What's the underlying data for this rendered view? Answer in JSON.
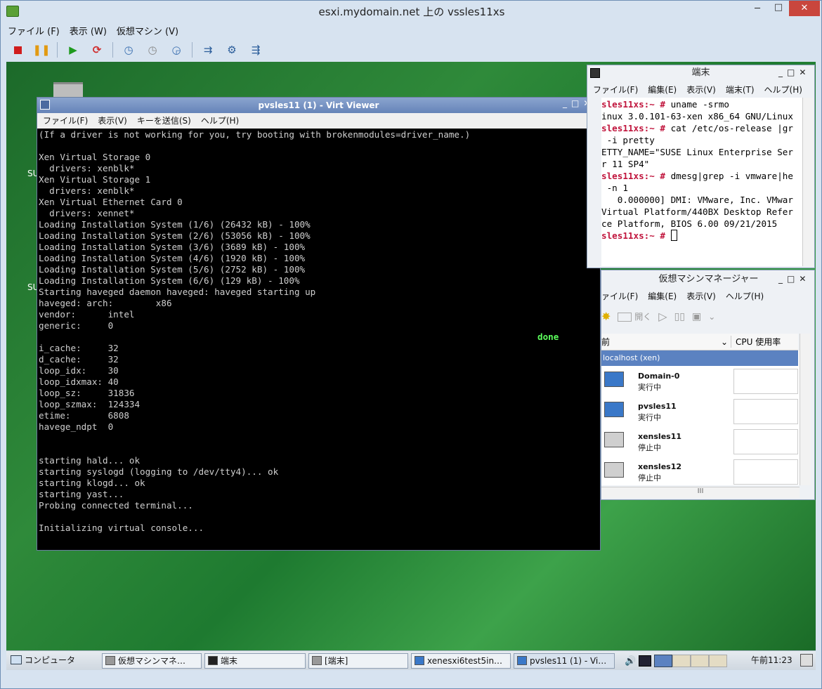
{
  "outer": {
    "title": "esxi.mydomain.net 上の vssles11xs",
    "menu": [
      "ファイル (F)",
      "表示 (W)",
      "仮想マシン (V)"
    ],
    "toolbar_icons": [
      "stop-icon",
      "pause-icon",
      "play-icon",
      "restart-icon",
      "snapshot-icon",
      "snapshot-revert-icon",
      "snapshot-manager-icon",
      "console-icon",
      "settings-icon",
      "devices-icon"
    ],
    "min": "─",
    "max": "□",
    "close": "✕"
  },
  "desktop": {
    "label1": "SU",
    "label2": "SU"
  },
  "virt_viewer": {
    "title": "pvsles11 (1) - Virt Viewer",
    "controls": "_□✕",
    "menu": [
      "ファイル(F)",
      "表示(V)",
      "キーを送信(S)",
      "ヘルプ(H)"
    ],
    "console_lines": [
      "(If a driver is not working for you, try booting with brokenmodules=driver_name.)",
      "",
      "Xen Virtual Storage 0",
      "  drivers: xenblk*",
      "Xen Virtual Storage 1",
      "  drivers: xenblk*",
      "Xen Virtual Ethernet Card 0",
      "  drivers: xennet*",
      "Loading Installation System (1/6) (26432 kB) - 100%",
      "Loading Installation System (2/6) (53056 kB) - 100%",
      "Loading Installation System (3/6) (3689 kB) - 100%",
      "Loading Installation System (4/6) (1920 kB) - 100%",
      "Loading Installation System (5/6) (2752 kB) - 100%",
      "Loading Installation System (6/6) (129 kB) - 100%",
      "Starting haveged daemon haveged: haveged starting up",
      "haveged: arch:        x86",
      "vendor:      intel",
      "generic:     0",
      "",
      "i_cache:     32",
      "d_cache:     32",
      "loop_idx:    30",
      "loop_idxmax: 40",
      "loop_sz:     31836",
      "loop_szmax:  124334",
      "etime:       6808",
      "havege_ndpt  0",
      "",
      "",
      "starting hald... ok",
      "starting syslogd (logging to /dev/tty4)... ok",
      "starting klogd... ok",
      "starting yast...",
      "Probing connected terminal...",
      "",
      "Initializing virtual console..."
    ],
    "done": "done"
  },
  "terminal": {
    "title": "端末",
    "controls": "_□✕",
    "menu": [
      "ファイル(F)",
      "編集(E)",
      "表示(V)",
      "端末(T)",
      "ヘルプ(H)"
    ],
    "lines": [
      {
        "prompt": "sles11xs:~ # ",
        "text": "uname -srmo"
      },
      {
        "prompt": "",
        "text": "inux 3.0.101-63-xen x86_64 GNU/Linux"
      },
      {
        "prompt": "sles11xs:~ # ",
        "text": "cat /etc/os-release |gr"
      },
      {
        "prompt": "",
        "text": " -i pretty"
      },
      {
        "prompt": "",
        "text": "ETTY_NAME=\"SUSE Linux Enterprise Ser"
      },
      {
        "prompt": "",
        "text": "r 11 SP4\""
      },
      {
        "prompt": "sles11xs:~ # ",
        "text": "dmesg|grep -i vmware|he"
      },
      {
        "prompt": "",
        "text": " -n 1"
      },
      {
        "prompt": "",
        "text": "   0.000000] DMI: VMware, Inc. VMwar"
      },
      {
        "prompt": "",
        "text": "Virtual Platform/440BX Desktop Refer"
      },
      {
        "prompt": "",
        "text": "ce Platform, BIOS 6.00 09/21/2015"
      },
      {
        "prompt": "sles11xs:~ # ",
        "text": ""
      }
    ]
  },
  "vmm": {
    "title": "仮想マシンマネージャー",
    "controls": "_□✕",
    "menu": [
      "ァイル(F)",
      "編集(E)",
      "表示(V)",
      "ヘルプ(H)"
    ],
    "toolbar": {
      "open": "開く"
    },
    "col_name": "前",
    "col_cpu": "CPU 使用率",
    "group": "localhost (xen)",
    "vms": [
      {
        "name": "Domain-0",
        "state": "実行中",
        "running": true
      },
      {
        "name": "pvsles11",
        "state": "実行中",
        "running": true
      },
      {
        "name": "xensles11",
        "state": "停止中",
        "running": false
      },
      {
        "name": "xensles12",
        "state": "停止中",
        "running": false
      }
    ],
    "hscroll": "III"
  },
  "taskbar": {
    "start": "コンピュータ",
    "tasks": [
      "仮想マシンマネ…",
      "端末",
      "[端末]",
      "xenesxi6test5in…",
      "pvsles11 (1) - Vi…"
    ],
    "clock": "午前11:23"
  },
  "colors": {
    "accent": "#5b82c1",
    "prompt": "#c0143c",
    "done": "#5cff5c",
    "close": "#c9463d"
  }
}
